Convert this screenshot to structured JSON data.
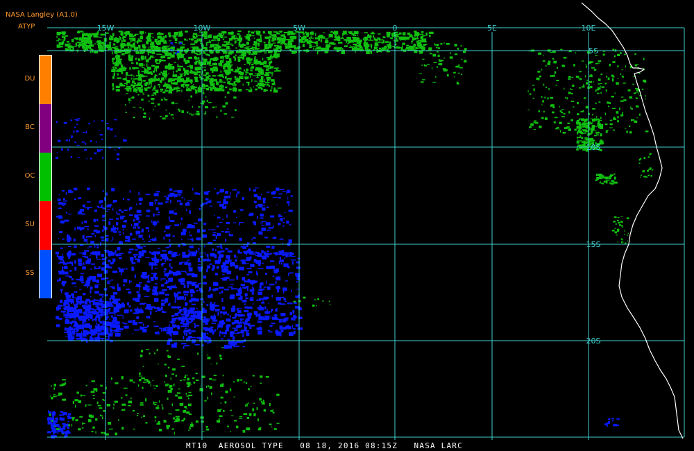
{
  "header": {
    "product": "NASA Langley (A1.0)",
    "parameter": "ATYP"
  },
  "legend": [
    {
      "code": "DU",
      "color": "#ff8000"
    },
    {
      "code": "BC",
      "color": "#800080"
    },
    {
      "code": "OC",
      "color": "#00c000"
    },
    {
      "code": "SU",
      "color": "#ff0000"
    },
    {
      "code": "SS",
      "color": "#0050ff"
    }
  ],
  "grid": {
    "color": "#40d0d0",
    "lon_labels": [
      "15W",
      "10W",
      "5W",
      "0",
      "5E",
      "10E"
    ],
    "lat_labels": [
      "5S",
      "10S",
      "15S",
      "20S"
    ]
  },
  "map": {
    "coastline_color": "#ffffff",
    "aerosol_colors": {
      "oc": "#10c010",
      "ss": "#0a1aff"
    }
  },
  "footer": "MT10  AEROSOL TYPE   08 18, 2016 08:15Z   NASA LARC"
}
